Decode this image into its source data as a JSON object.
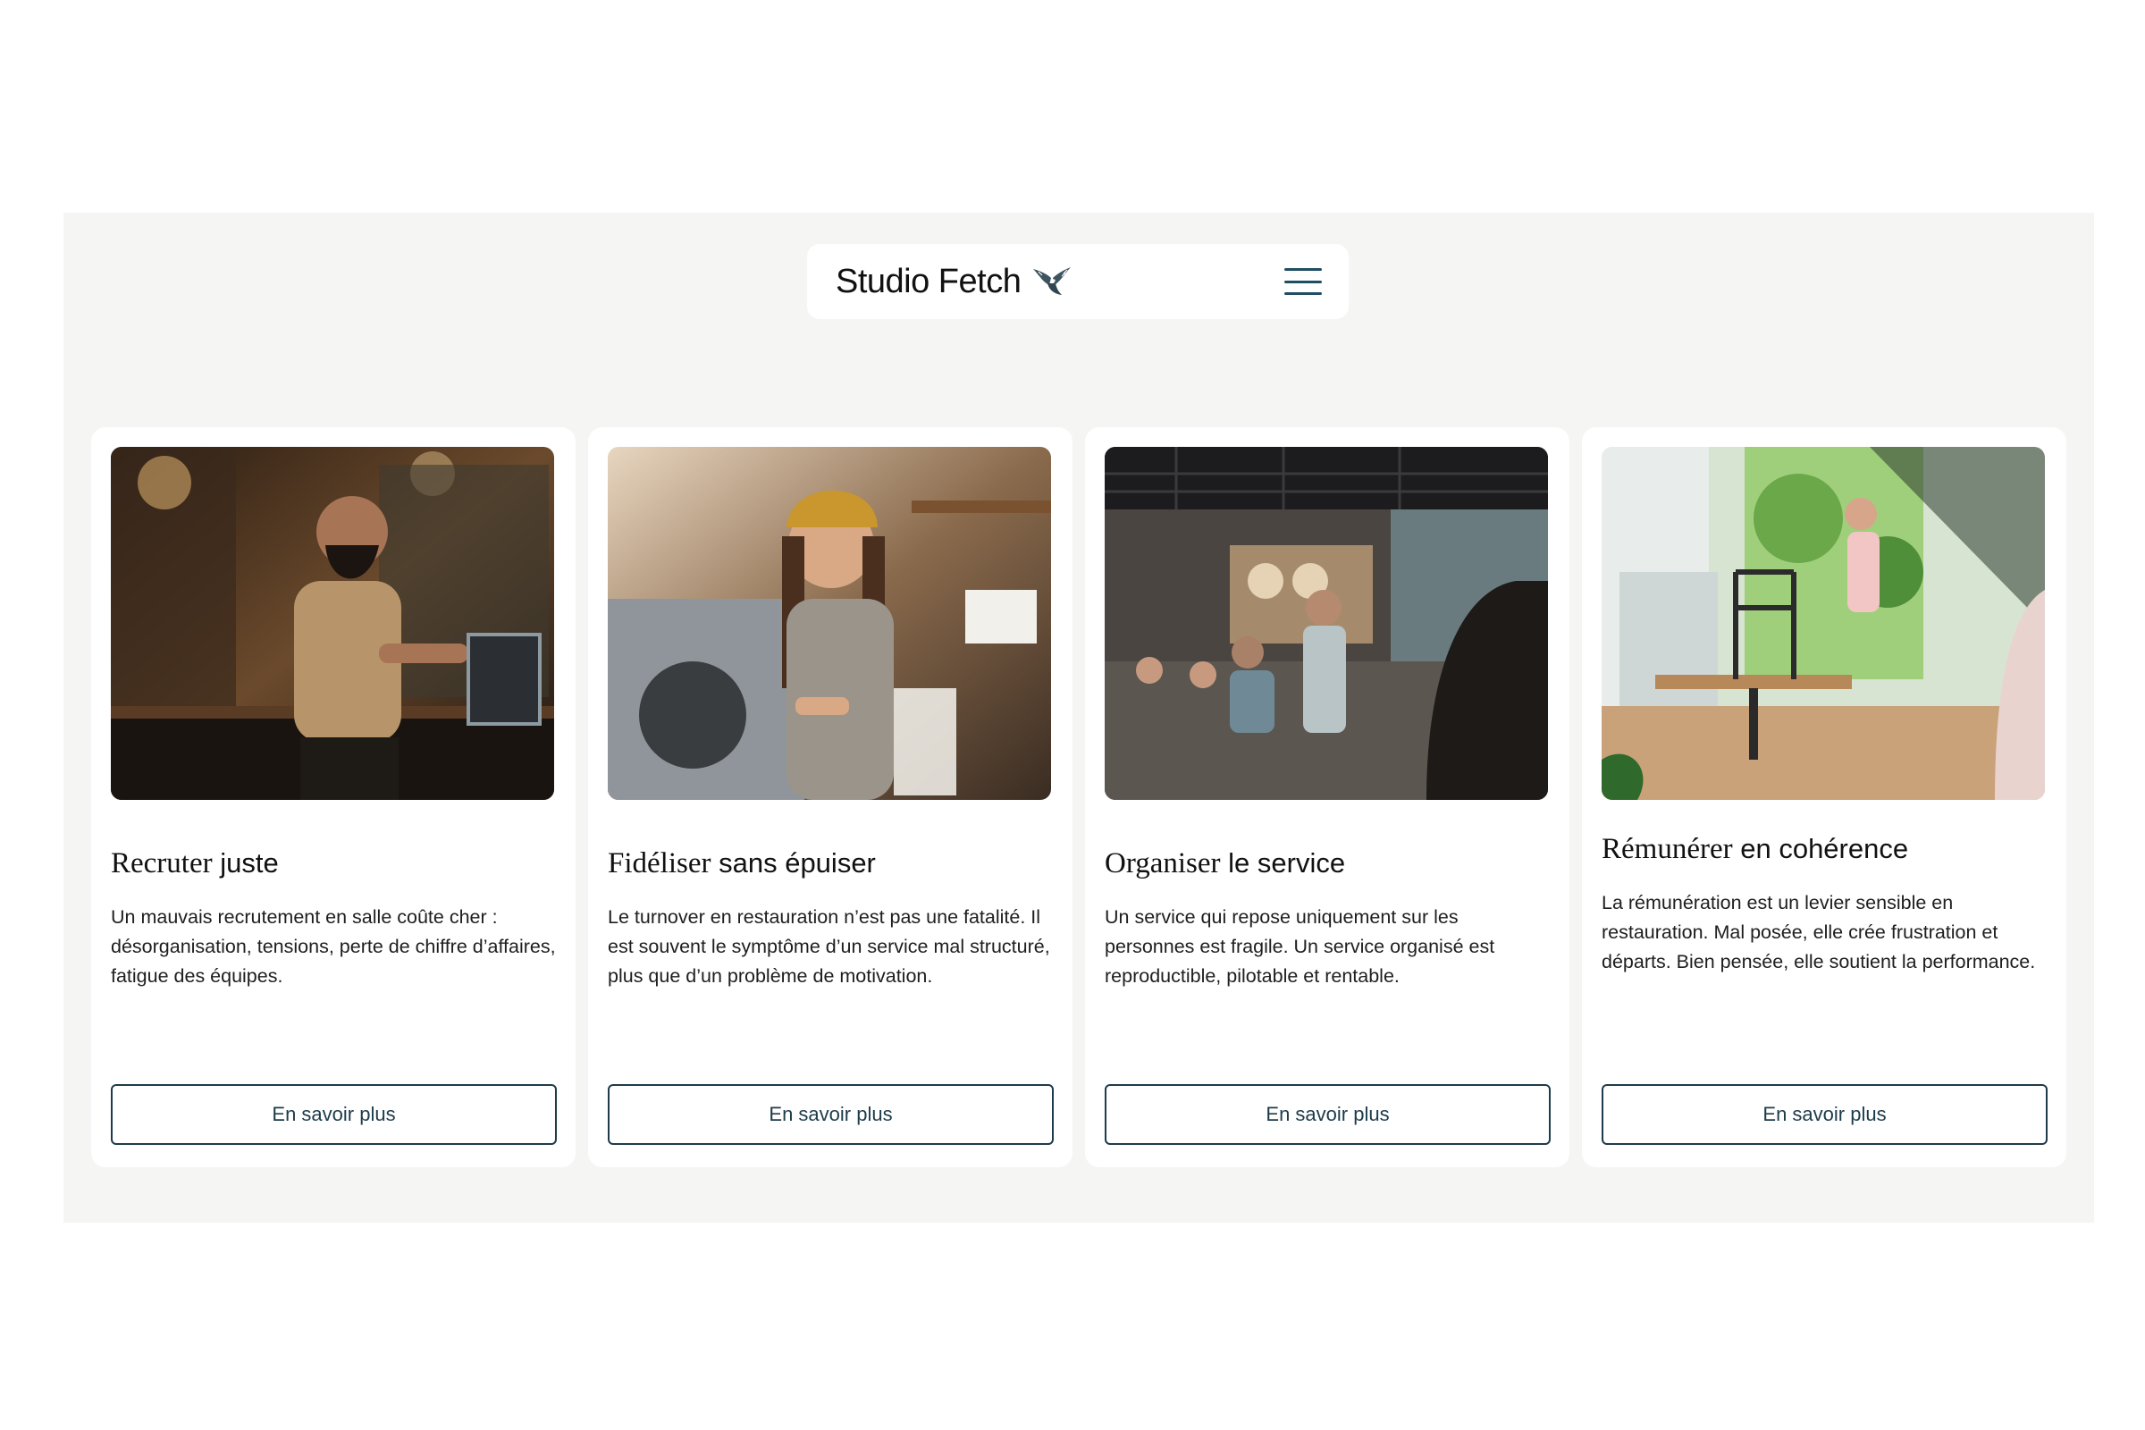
{
  "brand": {
    "name": "Studio Fetch",
    "logo_icon": "bird-icon"
  },
  "nav": {
    "menu_icon": "hamburger-menu-icon",
    "accent": "#1f4e63"
  },
  "colors": {
    "section_bg": "#f5f5f4",
    "card_bg": "#ffffff",
    "button_border": "#1d3b4a"
  },
  "cards": [
    {
      "image": "barista-at-register-photo",
      "title_serif": "Recruter",
      "title_sans": "juste",
      "text": "Un mauvais recrutement en salle coûte cher : désorganisation, tensions, perte de chiffre d’affaires, fatigue des équipes.",
      "button": "En savoir plus"
    },
    {
      "image": "barista-making-coffee-photo",
      "title_serif": "Fidéliser",
      "title_sans": "sans épuiser",
      "text": "Le turnover en restauration n’est pas une fatalité. Il est souvent le symptôme d’un service mal structuré, plus que d’un problème de motivation.",
      "button": "En savoir plus"
    },
    {
      "image": "busy-restaurant-service-photo",
      "title_serif": "Organiser",
      "title_sans": "le service",
      "text": "Un service qui repose uniquement sur les personnes est fragile. Un service organisé est reproductible, pilotable et rentable.",
      "button": "En savoir plus"
    },
    {
      "image": "staff-stacking-chairs-photo",
      "title_serif": "Rémunérer",
      "title_sans": "en cohérence",
      "text": "La rémunération est un levier sensible en restauration. Mal posée, elle crée frustration et départs. Bien pensée, elle soutient la performance.",
      "button": "En savoir plus"
    }
  ]
}
